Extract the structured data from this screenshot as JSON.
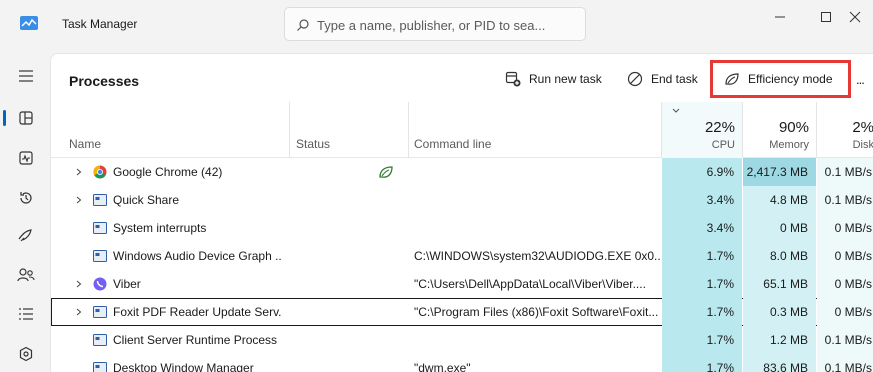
{
  "app": {
    "title": "Task Manager",
    "search_placeholder": "Type a name, publisher, or PID to sea..."
  },
  "sidebar": {
    "items": [
      {
        "icon": "hamburger-menu-icon"
      },
      {
        "icon": "processes-icon",
        "active": true
      },
      {
        "icon": "performance-icon"
      },
      {
        "icon": "app-history-icon"
      },
      {
        "icon": "startup-apps-icon"
      },
      {
        "icon": "users-icon"
      },
      {
        "icon": "details-icon"
      },
      {
        "icon": "services-icon"
      }
    ]
  },
  "toolbar": {
    "title": "Processes",
    "run_new_task": "Run new task",
    "end_task": "End task",
    "efficiency_mode": "Efficiency mode",
    "more": "..."
  },
  "columns": {
    "name": "Name",
    "status": "Status",
    "command_line": "Command line",
    "cpu_pct": "22%",
    "cpu_label": "CPU",
    "memory_pct": "90%",
    "memory_label": "Memory",
    "disk_pct": "2%",
    "disk_label": "Disk"
  },
  "rows": [
    {
      "name": "Google Chrome (42)",
      "expandable": true,
      "icon": "chrome-icon",
      "status_icon": "efficiency-leaf-icon",
      "command": "",
      "cpu": "6.9%",
      "memory": "2,417.3 MB",
      "disk": "0.1 MB/s"
    },
    {
      "name": "Quick Share",
      "expandable": true,
      "icon": "app-window-icon",
      "command": "",
      "cpu": "3.4%",
      "memory": "4.8 MB",
      "disk": "0.1 MB/s"
    },
    {
      "name": "System interrupts",
      "expandable": false,
      "icon": "app-window-icon",
      "command": "",
      "cpu": "3.4%",
      "memory": "0 MB",
      "disk": "0 MB/s"
    },
    {
      "name": "Windows Audio Device Graph ...",
      "expandable": false,
      "icon": "app-window-icon",
      "command": "C:\\WINDOWS\\system32\\AUDIODG.EXE 0x0...",
      "cpu": "1.7%",
      "memory": "8.0 MB",
      "disk": "0 MB/s"
    },
    {
      "name": "Viber",
      "expandable": true,
      "icon": "viber-icon",
      "command": "\"C:\\Users\\Dell\\AppData\\Local\\Viber\\Viber....",
      "cpu": "1.7%",
      "memory": "65.1 MB",
      "disk": "0 MB/s"
    },
    {
      "name": "Foxit PDF Reader Update Serv...",
      "expandable": true,
      "icon": "app-window-icon",
      "selected": true,
      "command": "\"C:\\Program Files (x86)\\Foxit Software\\Foxit...",
      "cpu": "1.7%",
      "memory": "0.3 MB",
      "disk": "0 MB/s"
    },
    {
      "name": "Client Server Runtime Process",
      "expandable": false,
      "icon": "app-window-icon",
      "command": "",
      "cpu": "1.7%",
      "memory": "1.2 MB",
      "disk": "0.1 MB/s"
    },
    {
      "name": "Desktop Window Manager",
      "expandable": false,
      "icon": "app-window-icon",
      "command": "\"dwm.exe\"",
      "cpu": "1.7%",
      "memory": "83.6 MB",
      "disk": "0.1 MB/s"
    }
  ],
  "colors": {
    "accent": "#0067c0",
    "highlight_box": "#e53935",
    "cpu_heat": "#b9e9ef",
    "memory_heat": "#d3f1f4",
    "memory_heat_high": "#9ed9e3"
  }
}
